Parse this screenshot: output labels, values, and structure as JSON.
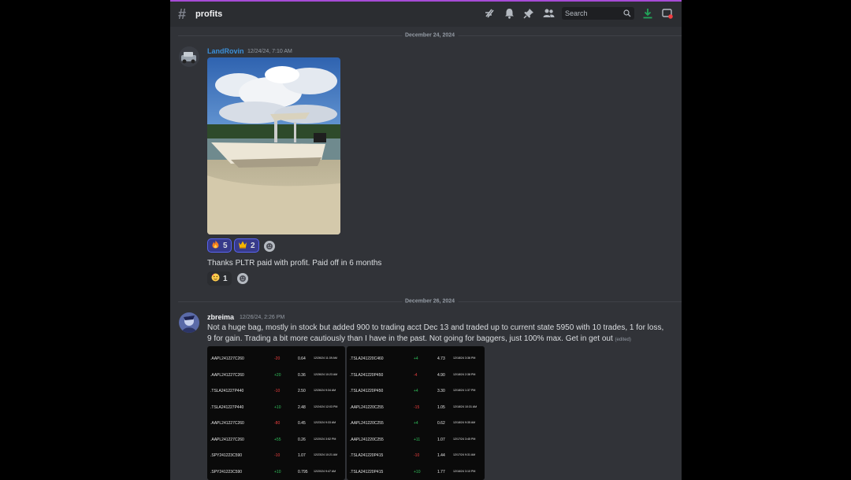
{
  "header": {
    "channel": "profits",
    "search_placeholder": "Search"
  },
  "dividers": [
    "December 24, 2024",
    "December 26, 2024"
  ],
  "messages": [
    {
      "author": "LandRovin",
      "author_color": "#3b8fd9",
      "timestamp": "12/24/24, 7:10 AM",
      "reactions": [
        {
          "emoji": "fire",
          "count": "5"
        },
        {
          "emoji": "crown",
          "count": "2"
        }
      ],
      "text": "Thanks PLTR paid with profit. Paid off in 6 months",
      "text_reactions": [
        {
          "emoji": "face",
          "count": "1"
        }
      ]
    },
    {
      "author": "zbreima",
      "author_color": "#f2f3f5",
      "timestamp": "12/26/24, 2:26 PM",
      "text": "Not a huge bag, mostly in stock but added 900 to trading acct Dec 13 and traded up to current state 5950 with 10 trades, 1 for loss, 9 for gain. Trading a bit more cautiously than I have in the past. Not going for baggers, just 100% max. Get in get out",
      "edited": "(edited)"
    }
  ],
  "trades_left": [
    {
      "sym": ".AAPL241227C260",
      "chg": "-20",
      "price": "0.64",
      "time": "12/26/24 11:39 AM"
    },
    {
      "sym": ".AAPL241227C260",
      "chg": "+20",
      "price": "0.36",
      "time": "12/26/24 10:23 AM"
    },
    {
      "sym": ".TSLA241227P440",
      "chg": "-10",
      "price": "2.50",
      "time": "12/26/24 9:34 AM"
    },
    {
      "sym": ".TSLA241227P440",
      "chg": "+10",
      "price": "2.48",
      "time": "12/24/24 12:03 PM"
    },
    {
      "sym": ".AAPL241227C260",
      "chg": "-80",
      "price": "0.45",
      "time": "12/23/24 9:33 AM"
    },
    {
      "sym": ".AAPL241227C260",
      "chg": "+55",
      "price": "0.26",
      "time": "12/20/24 3:52 PM"
    },
    {
      "sym": ".SPY241223C590",
      "chg": "-10",
      "price": "1.07",
      "time": "12/23/24 10:21 AM"
    },
    {
      "sym": ".SPY241223C590",
      "chg": "+10",
      "price": "0.795",
      "time": "12/20/24 9:47 AM"
    }
  ],
  "trades_right": [
    {
      "sym": ".TSLA241220C460",
      "chg": "+4",
      "price": "4.73",
      "time": "12/18/24 3:36 PM"
    },
    {
      "sym": ".TSLA241220P450",
      "chg": "-4",
      "price": "4.90",
      "time": "12/18/24 2:38 PM"
    },
    {
      "sym": ".TSLA241220P450",
      "chg": "+4",
      "price": "3.30",
      "time": "12/18/24 1:37 PM"
    },
    {
      "sym": ".AAPL241220C255",
      "chg": "-15",
      "price": "1.05",
      "time": "12/18/24 10:31 AM"
    },
    {
      "sym": ".AAPL241220C255",
      "chg": "+4",
      "price": "0.62",
      "time": "12/18/24 9:35 AM"
    },
    {
      "sym": ".AAPL241220C255",
      "chg": "+11",
      "price": "1.07",
      "time": "12/17/24 3:45 PM"
    },
    {
      "sym": ".TSLA241220P415",
      "chg": "-10",
      "price": "1.44",
      "time": "12/17/24 9:31 AM"
    },
    {
      "sym": ".TSLA241220P415",
      "chg": "+10",
      "price": "1.77",
      "time": "12/16/24 3:10 PM"
    }
  ],
  "colors": {
    "accent": "#5865f2",
    "gain": "#31c15c",
    "loss": "#f04040",
    "background": "#313338"
  }
}
